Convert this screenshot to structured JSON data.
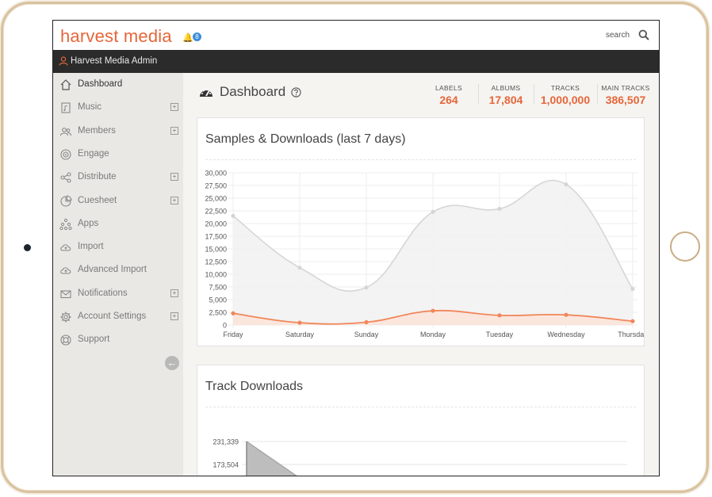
{
  "app": {
    "logo_text": "harvest media",
    "notification_count": "8",
    "search_label": "search",
    "admin_name": "Harvest Media Admin"
  },
  "sidebar": {
    "items": [
      {
        "label": "Dashboard",
        "icon": "home-icon",
        "expandable": false,
        "active": true
      },
      {
        "label": "Music",
        "icon": "music-file-icon",
        "expandable": true
      },
      {
        "label": "Members",
        "icon": "members-icon",
        "expandable": true
      },
      {
        "label": "Engage",
        "icon": "target-icon",
        "expandable": false
      },
      {
        "label": "Distribute",
        "icon": "share-icon",
        "expandable": true
      },
      {
        "label": "Cuesheet",
        "icon": "pie-chart-icon",
        "expandable": true
      },
      {
        "label": "Apps",
        "icon": "apps-icon",
        "expandable": false
      },
      {
        "label": "Import",
        "icon": "cloud-upload-icon",
        "expandable": false
      },
      {
        "label": "Advanced Import",
        "icon": "cloud-upload-icon",
        "expandable": false
      },
      {
        "label": "Notifications",
        "icon": "envelope-icon",
        "expandable": true
      },
      {
        "label": "Account Settings",
        "icon": "gear-icon",
        "expandable": true
      },
      {
        "label": "Support",
        "icon": "lifebuoy-icon",
        "expandable": false
      }
    ],
    "expand_glyph": "+",
    "collapse_glyph": "←"
  },
  "dashboard": {
    "title": "Dashboard",
    "stats": [
      {
        "label": "LABELS",
        "value": "264"
      },
      {
        "label": "ALBUMS",
        "value": "17,804"
      },
      {
        "label": "TRACKS",
        "value": "1,000,000"
      },
      {
        "label": "MAIN TRACKS",
        "value": "386,507"
      }
    ]
  },
  "colors": {
    "accent": "#e5663a",
    "samples_line": "#d6d6d6",
    "downloads_line": "#f0875a"
  },
  "chart_data": [
    {
      "type": "line",
      "title": "Samples & Downloads (last 7 days)",
      "x": [
        "Friday",
        "Saturday",
        "Sunday",
        "Monday",
        "Tuesday",
        "Wednesday",
        "Thursday"
      ],
      "y_ticks": [
        "0",
        "2,500",
        "5,000",
        "7,500",
        "10,000",
        "12,500",
        "15,000",
        "17,500",
        "20,000",
        "22,500",
        "25,000",
        "27,500",
        "30,000"
      ],
      "ylim": [
        0,
        30000
      ],
      "grid": true,
      "series": [
        {
          "values": [
            21500,
            11300,
            7400,
            22300,
            22900,
            27700,
            7100
          ],
          "color": "#d6d6d6",
          "fill": "#f1f1f1"
        },
        {
          "values": [
            2300,
            450,
            550,
            2800,
            1900,
            2000,
            750
          ],
          "color": "#f0875a",
          "fill": "#fbe3d8"
        }
      ]
    },
    {
      "type": "area",
      "title": "Track Downloads",
      "y_ticks": [
        "231,339",
        "173,504"
      ],
      "series": [
        {
          "values": [
            231339,
            173504
          ],
          "color": "#a8a8a8"
        }
      ]
    }
  ]
}
